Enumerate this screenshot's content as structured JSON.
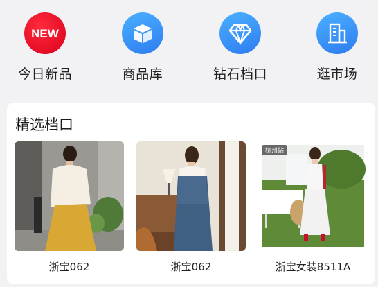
{
  "quick_nav": [
    {
      "label": "今日新品",
      "icon": "new-badge-icon",
      "icon_text": "NEW"
    },
    {
      "label": "商品库",
      "icon": "box-icon"
    },
    {
      "label": "钻石档口",
      "icon": "diamond-icon"
    },
    {
      "label": "逛市场",
      "icon": "building-icon"
    }
  ],
  "featured": {
    "title": "精选档口",
    "shops": [
      {
        "name": "浙宝062"
      },
      {
        "name": "浙宝062"
      },
      {
        "name": "浙宝女装8511A",
        "badge": "杭州站"
      }
    ]
  },
  "colors": {
    "new_red": "#e60023",
    "icon_blue": "#3a8ff5",
    "page_bg": "#f2f2f4"
  }
}
